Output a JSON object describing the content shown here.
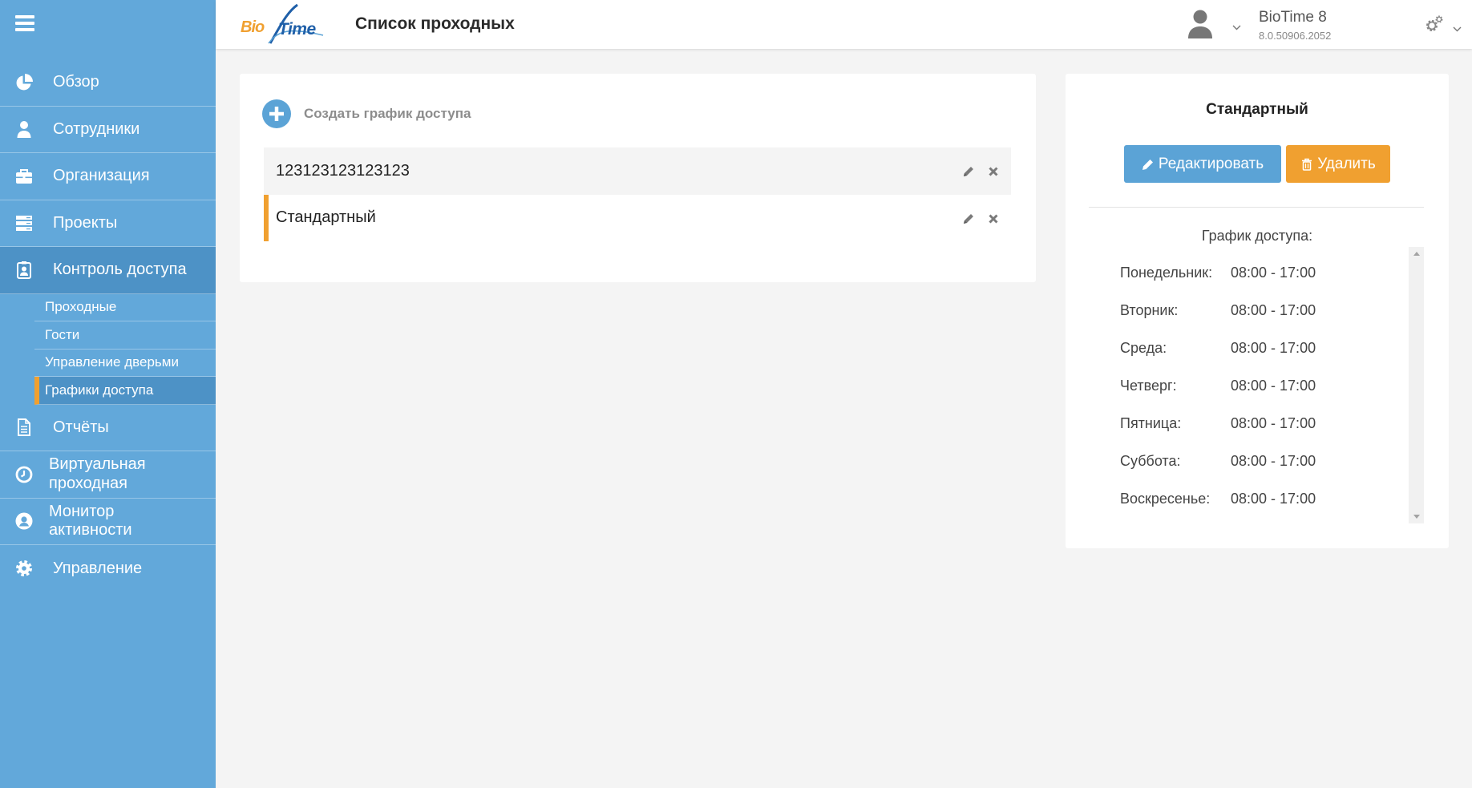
{
  "logo": {
    "part1": "Bio",
    "part2": "Time"
  },
  "header": {
    "title": "Список проходных",
    "product": "BioTime 8",
    "version": "8.0.50906.2052"
  },
  "sidebar": {
    "items": [
      {
        "label": "Обзор",
        "icon": "pie-chart-icon"
      },
      {
        "label": "Сотрудники",
        "icon": "user-icon"
      },
      {
        "label": "Организация",
        "icon": "briefcase-icon"
      },
      {
        "label": "Проекты",
        "icon": "server-icon"
      },
      {
        "label": "Контроль доступа",
        "icon": "id-badge-icon",
        "active": true
      },
      {
        "label": "Отчёты",
        "icon": "file-icon"
      },
      {
        "label": "Виртуальная проходная",
        "icon": "clock-icon"
      },
      {
        "label": "Монитор активности",
        "icon": "user-circle-icon"
      },
      {
        "label": "Управление",
        "icon": "gear-icon"
      }
    ],
    "submenu": [
      {
        "label": "Проходные"
      },
      {
        "label": "Гости"
      },
      {
        "label": "Управление дверьми"
      },
      {
        "label": "Графики доступа",
        "active": true
      }
    ]
  },
  "schedule_list": {
    "create_label": "Создать график доступа",
    "items": [
      {
        "name": "123123123123123"
      },
      {
        "name": "Стандартный",
        "selected": true
      }
    ]
  },
  "detail": {
    "title": "Стандартный",
    "edit_label": "Редактировать",
    "delete_label": "Удалить",
    "schedule_heading": "График доступа:",
    "days": [
      {
        "day": "Понедельник:",
        "time": "08:00 - 17:00"
      },
      {
        "day": "Вторник:",
        "time": "08:00 - 17:00"
      },
      {
        "day": "Среда:",
        "time": "08:00 - 17:00"
      },
      {
        "day": "Четверг:",
        "time": "08:00 - 17:00"
      },
      {
        "day": "Пятница:",
        "time": "08:00 - 17:00"
      },
      {
        "day": "Суббота:",
        "time": "08:00 - 17:00"
      },
      {
        "day": "Воскресенье:",
        "time": "08:00 - 17:00"
      }
    ]
  },
  "colors": {
    "sidebar": "#62a8da",
    "sidebar_active": "#4d92c6",
    "accent": "#f0a030",
    "primary": "#5ba3d6"
  }
}
